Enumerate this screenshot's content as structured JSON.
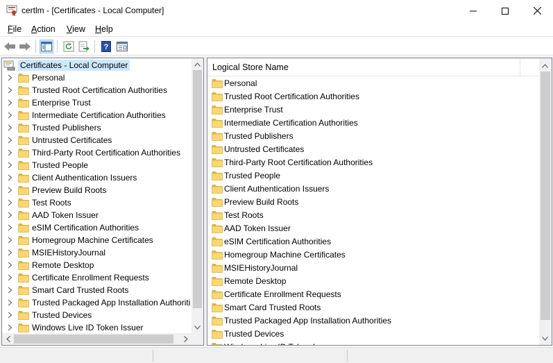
{
  "window": {
    "title": "certlm - [Certificates - Local Computer]"
  },
  "menu": [
    {
      "label": "File",
      "accel": "F",
      "rest": "ile"
    },
    {
      "label": "Action",
      "accel": "A",
      "rest": "ction"
    },
    {
      "label": "View",
      "accel": "V",
      "rest": "iew"
    },
    {
      "label": "Help",
      "accel": "H",
      "rest": "elp"
    }
  ],
  "toolbar": {
    "buttons": [
      "back-arrow-icon",
      "forward-arrow-icon",
      "show-hide-console-tree-icon",
      "refresh-icon",
      "export-list-icon",
      "help-icon",
      "properties-icon"
    ]
  },
  "tree": {
    "root_label": "Certificates - Local Computer",
    "items": [
      "Personal",
      "Trusted Root Certification Authorities",
      "Enterprise Trust",
      "Intermediate Certification Authorities",
      "Trusted Publishers",
      "Untrusted Certificates",
      "Third-Party Root Certification Authorities",
      "Trusted People",
      "Client Authentication Issuers",
      "Preview Build Roots",
      "Test Roots",
      "AAD Token Issuer",
      "eSIM Certification Authorities",
      "Homegroup Machine Certificates",
      "MSIEHistoryJournal",
      "Remote Desktop",
      "Certificate Enrollment Requests",
      "Smart Card Trusted Roots",
      "Trusted Packaged App Installation Authoriti",
      "Trusted Devices",
      "Windows Live ID Token Issuer"
    ]
  },
  "list": {
    "column_header": "Logical Store Name",
    "items": [
      "Personal",
      "Trusted Root Certification Authorities",
      "Enterprise Trust",
      "Intermediate Certification Authorities",
      "Trusted Publishers",
      "Untrusted Certificates",
      "Third-Party Root Certification Authorities",
      "Trusted People",
      "Client Authentication Issuers",
      "Preview Build Roots",
      "Test Roots",
      "AAD Token Issuer",
      "eSIM Certification Authorities",
      "Homegroup Machine Certificates",
      "MSIEHistoryJournal",
      "Remote Desktop",
      "Certificate Enrollment Requests",
      "Smart Card Trusted Roots",
      "Trusted Packaged App Installation Authorities",
      "Trusted Devices",
      "Windows Live ID Token Issuer"
    ]
  },
  "colors": {
    "selection": "#cce8ff",
    "folder": "#f8d775",
    "folder_dark": "#e0b23d"
  }
}
